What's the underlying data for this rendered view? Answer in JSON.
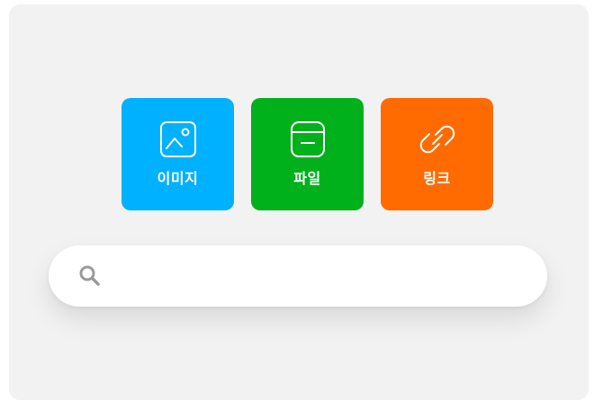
{
  "tiles": [
    {
      "label": "이미지",
      "icon": "image-icon",
      "color": "#00b1ff"
    },
    {
      "label": "파일",
      "icon": "file-icon",
      "color": "#00b11c"
    },
    {
      "label": "링크",
      "icon": "link-icon",
      "color": "#ff6b00"
    }
  ],
  "search": {
    "icon": "search-icon",
    "value": "",
    "placeholder": ""
  },
  "colors": {
    "panel_background": "#f2f2f2",
    "search_background": "#ffffff",
    "icon_gray": "#9a9a9a"
  }
}
